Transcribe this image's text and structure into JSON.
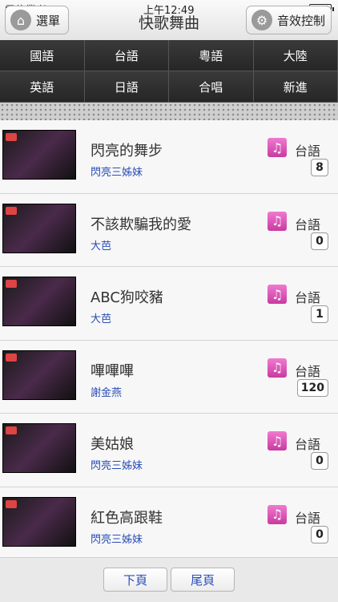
{
  "status_bar": {
    "carrier": "電信業者",
    "time": "上午12:49"
  },
  "header": {
    "title": "快歌舞曲",
    "menu_label": "選單",
    "sound_label": "音效控制"
  },
  "categories": [
    {
      "label": "國語"
    },
    {
      "label": "台語"
    },
    {
      "label": "粵語"
    },
    {
      "label": "大陸"
    },
    {
      "label": "英語"
    },
    {
      "label": "日語"
    },
    {
      "label": "合唱"
    },
    {
      "label": "新進"
    }
  ],
  "songs": [
    {
      "title": "閃亮的舞步",
      "artist": "閃亮三姊妹",
      "language": "台語",
      "count": "8"
    },
    {
      "title": "不該欺騙我的愛",
      "artist": "大芭",
      "language": "台語",
      "count": "0"
    },
    {
      "title": "ABC狗咬豬",
      "artist": "大芭",
      "language": "台語",
      "count": "1"
    },
    {
      "title": "嗶嗶嗶",
      "artist": "謝金燕",
      "language": "台語",
      "count": "120"
    },
    {
      "title": "美姑娘",
      "artist": "閃亮三姊妹",
      "language": "台語",
      "count": "0"
    },
    {
      "title": "紅色高跟鞋",
      "artist": "閃亮三姊妹",
      "language": "台語",
      "count": "0"
    }
  ],
  "pager": {
    "next_label": "下頁",
    "last_label": "尾頁"
  }
}
